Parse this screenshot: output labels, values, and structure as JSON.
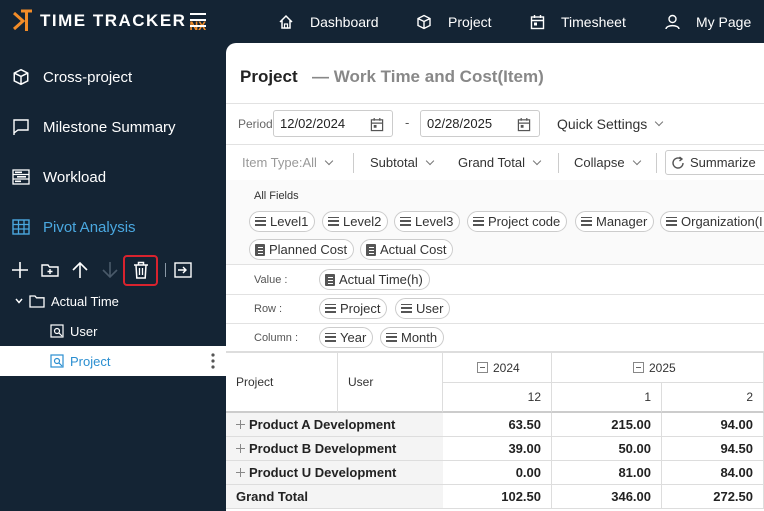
{
  "app": {
    "logo_text": "TIME TRACKER",
    "logo_suffix": "NX"
  },
  "nav": [
    {
      "label": "Dashboard",
      "icon": "home-icon"
    },
    {
      "label": "Project",
      "icon": "cube-icon"
    },
    {
      "label": "Timesheet",
      "icon": "calendar-icon"
    },
    {
      "label": "My Page",
      "icon": "user-icon"
    }
  ],
  "sidebar": {
    "items": [
      {
        "label": "Cross-project",
        "icon": "cube-icon"
      },
      {
        "label": "Milestone Summary",
        "icon": "flag-icon"
      },
      {
        "label": "Workload",
        "icon": "workload-icon"
      },
      {
        "label": "Pivot Analysis",
        "icon": "grid-icon"
      }
    ],
    "tree": [
      {
        "label": "Actual Time",
        "type": "folder"
      },
      {
        "label": "User",
        "type": "view"
      },
      {
        "label": "Project",
        "type": "view"
      }
    ]
  },
  "page": {
    "title": "Project",
    "subtitle": "— Work Time and Cost(Item)"
  },
  "period": {
    "label": "Period",
    "from": "12/02/2024",
    "dash": "-",
    "to": "02/28/2025",
    "quick_settings": "Quick Settings"
  },
  "options": {
    "item_type": "Item Type:All",
    "subtotal": "Subtotal",
    "grand_total": "Grand Total",
    "collapse": "Collapse",
    "summarize": "Summarize"
  },
  "fields": {
    "label": "All Fields",
    "chips": [
      "Level1",
      "Level2",
      "Level3",
      "Project code",
      "Manager",
      "Organization(I",
      "Planned Cost",
      "Actual Cost"
    ]
  },
  "zones": {
    "value_label": "Value :",
    "value_chips": [
      "Actual Time(h)"
    ],
    "row_label": "Row :",
    "row_chips": [
      "Project",
      "User"
    ],
    "column_label": "Column :",
    "column_chips": [
      "Year",
      "Month"
    ]
  },
  "grid": {
    "col_project": "Project",
    "col_user": "User",
    "years": [
      "2024",
      "2025"
    ],
    "months": [
      "12",
      "1",
      "2"
    ],
    "rows": [
      {
        "label": "Product A Development",
        "values": [
          "63.50",
          "215.00",
          "94.00"
        ]
      },
      {
        "label": "Product B Development",
        "values": [
          "39.00",
          "50.00",
          "94.50"
        ]
      },
      {
        "label": "Product U Development",
        "values": [
          "0.00",
          "81.00",
          "84.00"
        ]
      }
    ],
    "total": {
      "label": "Grand Total",
      "values": [
        "102.50",
        "346.00",
        "272.50"
      ]
    }
  }
}
